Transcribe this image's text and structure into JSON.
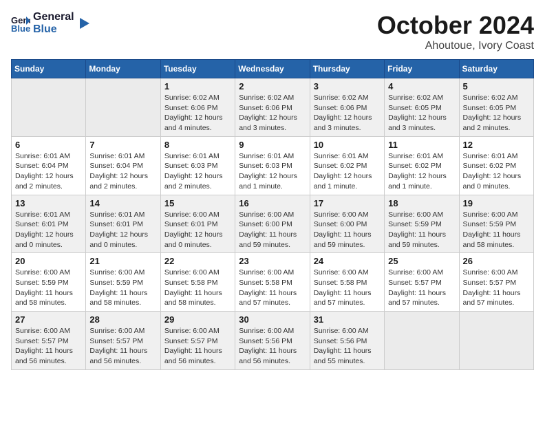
{
  "header": {
    "logo_line1": "General",
    "logo_line2": "Blue",
    "month": "October 2024",
    "location": "Ahoutoue, Ivory Coast"
  },
  "days_of_week": [
    "Sunday",
    "Monday",
    "Tuesday",
    "Wednesday",
    "Thursday",
    "Friday",
    "Saturday"
  ],
  "weeks": [
    [
      {
        "day": "",
        "detail": ""
      },
      {
        "day": "",
        "detail": ""
      },
      {
        "day": "1",
        "detail": "Sunrise: 6:02 AM\nSunset: 6:06 PM\nDaylight: 12 hours and 4 minutes."
      },
      {
        "day": "2",
        "detail": "Sunrise: 6:02 AM\nSunset: 6:06 PM\nDaylight: 12 hours and 3 minutes."
      },
      {
        "day": "3",
        "detail": "Sunrise: 6:02 AM\nSunset: 6:06 PM\nDaylight: 12 hours and 3 minutes."
      },
      {
        "day": "4",
        "detail": "Sunrise: 6:02 AM\nSunset: 6:05 PM\nDaylight: 12 hours and 3 minutes."
      },
      {
        "day": "5",
        "detail": "Sunrise: 6:02 AM\nSunset: 6:05 PM\nDaylight: 12 hours and 2 minutes."
      }
    ],
    [
      {
        "day": "6",
        "detail": "Sunrise: 6:01 AM\nSunset: 6:04 PM\nDaylight: 12 hours and 2 minutes."
      },
      {
        "day": "7",
        "detail": "Sunrise: 6:01 AM\nSunset: 6:04 PM\nDaylight: 12 hours and 2 minutes."
      },
      {
        "day": "8",
        "detail": "Sunrise: 6:01 AM\nSunset: 6:03 PM\nDaylight: 12 hours and 2 minutes."
      },
      {
        "day": "9",
        "detail": "Sunrise: 6:01 AM\nSunset: 6:03 PM\nDaylight: 12 hours and 1 minute."
      },
      {
        "day": "10",
        "detail": "Sunrise: 6:01 AM\nSunset: 6:02 PM\nDaylight: 12 hours and 1 minute."
      },
      {
        "day": "11",
        "detail": "Sunrise: 6:01 AM\nSunset: 6:02 PM\nDaylight: 12 hours and 1 minute."
      },
      {
        "day": "12",
        "detail": "Sunrise: 6:01 AM\nSunset: 6:02 PM\nDaylight: 12 hours and 0 minutes."
      }
    ],
    [
      {
        "day": "13",
        "detail": "Sunrise: 6:01 AM\nSunset: 6:01 PM\nDaylight: 12 hours and 0 minutes."
      },
      {
        "day": "14",
        "detail": "Sunrise: 6:01 AM\nSunset: 6:01 PM\nDaylight: 12 hours and 0 minutes."
      },
      {
        "day": "15",
        "detail": "Sunrise: 6:00 AM\nSunset: 6:01 PM\nDaylight: 12 hours and 0 minutes."
      },
      {
        "day": "16",
        "detail": "Sunrise: 6:00 AM\nSunset: 6:00 PM\nDaylight: 11 hours and 59 minutes."
      },
      {
        "day": "17",
        "detail": "Sunrise: 6:00 AM\nSunset: 6:00 PM\nDaylight: 11 hours and 59 minutes."
      },
      {
        "day": "18",
        "detail": "Sunrise: 6:00 AM\nSunset: 5:59 PM\nDaylight: 11 hours and 59 minutes."
      },
      {
        "day": "19",
        "detail": "Sunrise: 6:00 AM\nSunset: 5:59 PM\nDaylight: 11 hours and 58 minutes."
      }
    ],
    [
      {
        "day": "20",
        "detail": "Sunrise: 6:00 AM\nSunset: 5:59 PM\nDaylight: 11 hours and 58 minutes."
      },
      {
        "day": "21",
        "detail": "Sunrise: 6:00 AM\nSunset: 5:59 PM\nDaylight: 11 hours and 58 minutes."
      },
      {
        "day": "22",
        "detail": "Sunrise: 6:00 AM\nSunset: 5:58 PM\nDaylight: 11 hours and 58 minutes."
      },
      {
        "day": "23",
        "detail": "Sunrise: 6:00 AM\nSunset: 5:58 PM\nDaylight: 11 hours and 57 minutes."
      },
      {
        "day": "24",
        "detail": "Sunrise: 6:00 AM\nSunset: 5:58 PM\nDaylight: 11 hours and 57 minutes."
      },
      {
        "day": "25",
        "detail": "Sunrise: 6:00 AM\nSunset: 5:57 PM\nDaylight: 11 hours and 57 minutes."
      },
      {
        "day": "26",
        "detail": "Sunrise: 6:00 AM\nSunset: 5:57 PM\nDaylight: 11 hours and 57 minutes."
      }
    ],
    [
      {
        "day": "27",
        "detail": "Sunrise: 6:00 AM\nSunset: 5:57 PM\nDaylight: 11 hours and 56 minutes."
      },
      {
        "day": "28",
        "detail": "Sunrise: 6:00 AM\nSunset: 5:57 PM\nDaylight: 11 hours and 56 minutes."
      },
      {
        "day": "29",
        "detail": "Sunrise: 6:00 AM\nSunset: 5:57 PM\nDaylight: 11 hours and 56 minutes."
      },
      {
        "day": "30",
        "detail": "Sunrise: 6:00 AM\nSunset: 5:56 PM\nDaylight: 11 hours and 56 minutes."
      },
      {
        "day": "31",
        "detail": "Sunrise: 6:00 AM\nSunset: 5:56 PM\nDaylight: 11 hours and 55 minutes."
      },
      {
        "day": "",
        "detail": ""
      },
      {
        "day": "",
        "detail": ""
      }
    ]
  ]
}
